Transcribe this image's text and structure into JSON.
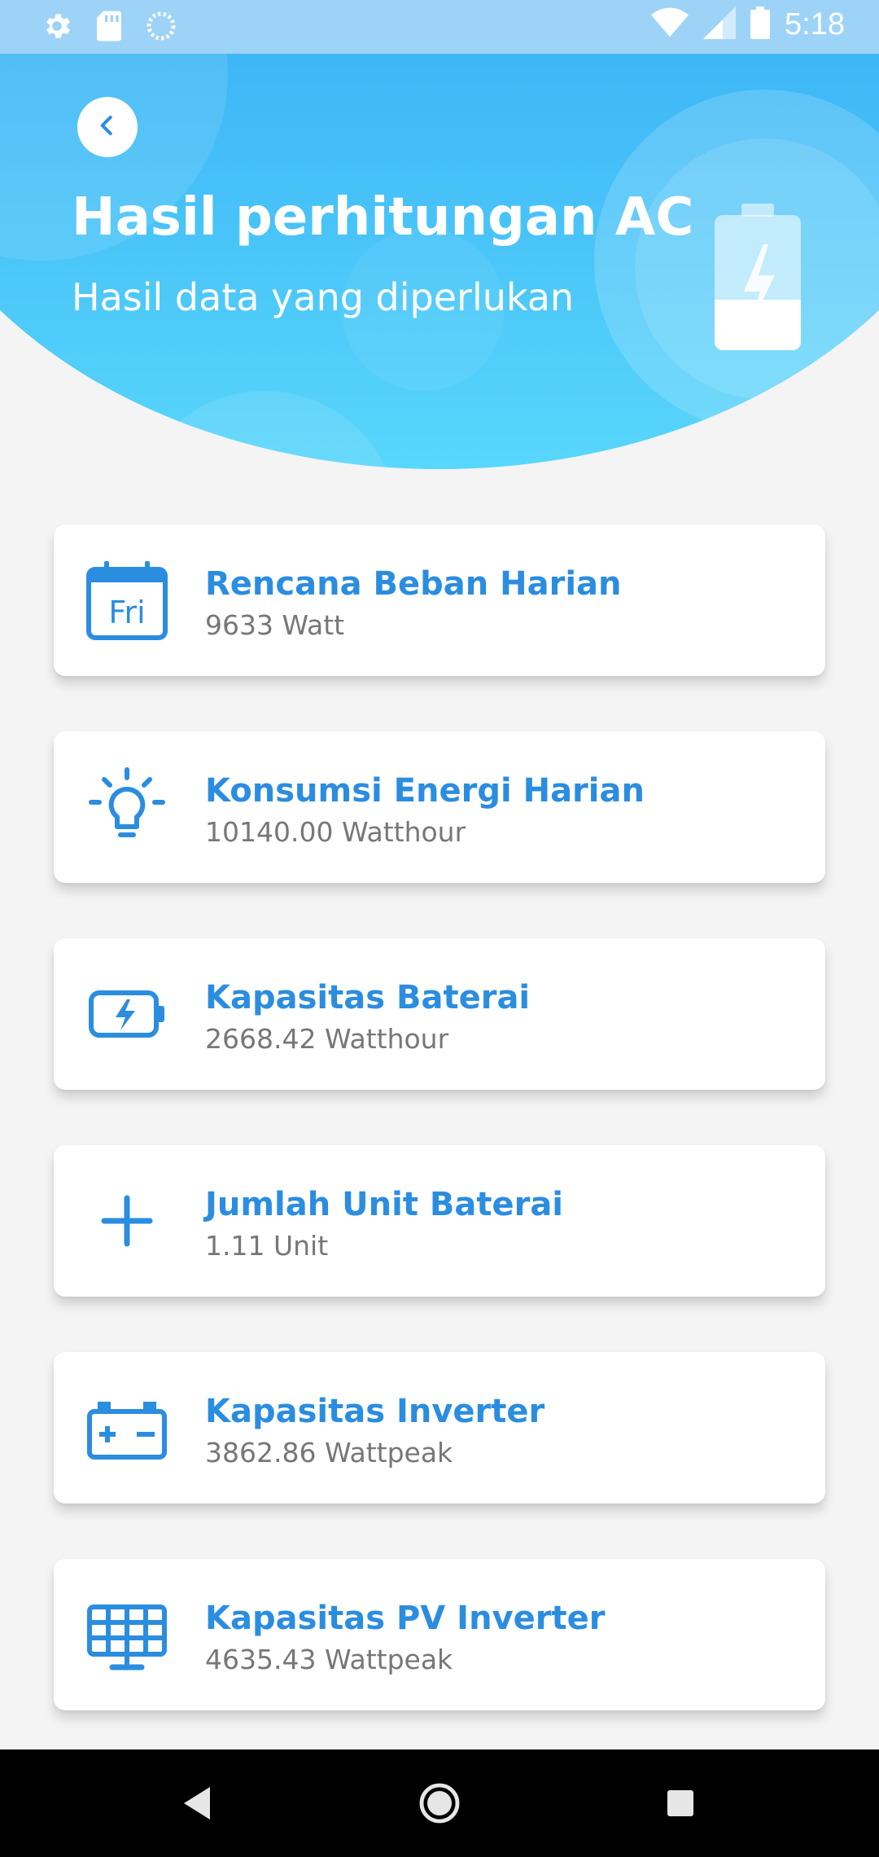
{
  "status_bar": {
    "time": "5:18",
    "left_icons": [
      "gear-icon",
      "sd-card-icon",
      "sync-icon"
    ],
    "right_icons": [
      "wifi-icon",
      "signal-icon",
      "battery-icon"
    ]
  },
  "header": {
    "title": "Hasil perhitungan AC",
    "subtitle": "Hasil data yang diperlukan",
    "back_icon": "chevron-left-icon",
    "hero_icon": "battery-charging-icon"
  },
  "cards": [
    {
      "icon": "calendar-icon",
      "icon_text": "Fri",
      "title": "Rencana Beban Harian",
      "value": "9633 Watt"
    },
    {
      "icon": "lightbulb-icon",
      "title": "Konsumsi Energi Harian",
      "value": "10140.00 Watthour"
    },
    {
      "icon": "battery-charge-icon",
      "title": "Kapasitas Baterai",
      "value": "2668.42 Watthour"
    },
    {
      "icon": "plus-icon",
      "title": "Jumlah Unit Baterai",
      "value": "1.11 Unit"
    },
    {
      "icon": "car-battery-icon",
      "title": "Kapasitas Inverter",
      "value": "3862.86 Wattpeak"
    },
    {
      "icon": "solar-panel-icon",
      "title": "Kapasitas PV Inverter",
      "value": "4635.43 Wattpeak"
    }
  ],
  "nav_bar": {
    "items": [
      "back-triangle-icon",
      "home-circle-icon",
      "recents-square-icon"
    ]
  },
  "colors": {
    "accent": "#2b8de0",
    "header_top": "#2f9ff2",
    "header_bottom": "#58d6fb",
    "background": "#f4f4f4",
    "status_bar": "#9ed3f8"
  }
}
